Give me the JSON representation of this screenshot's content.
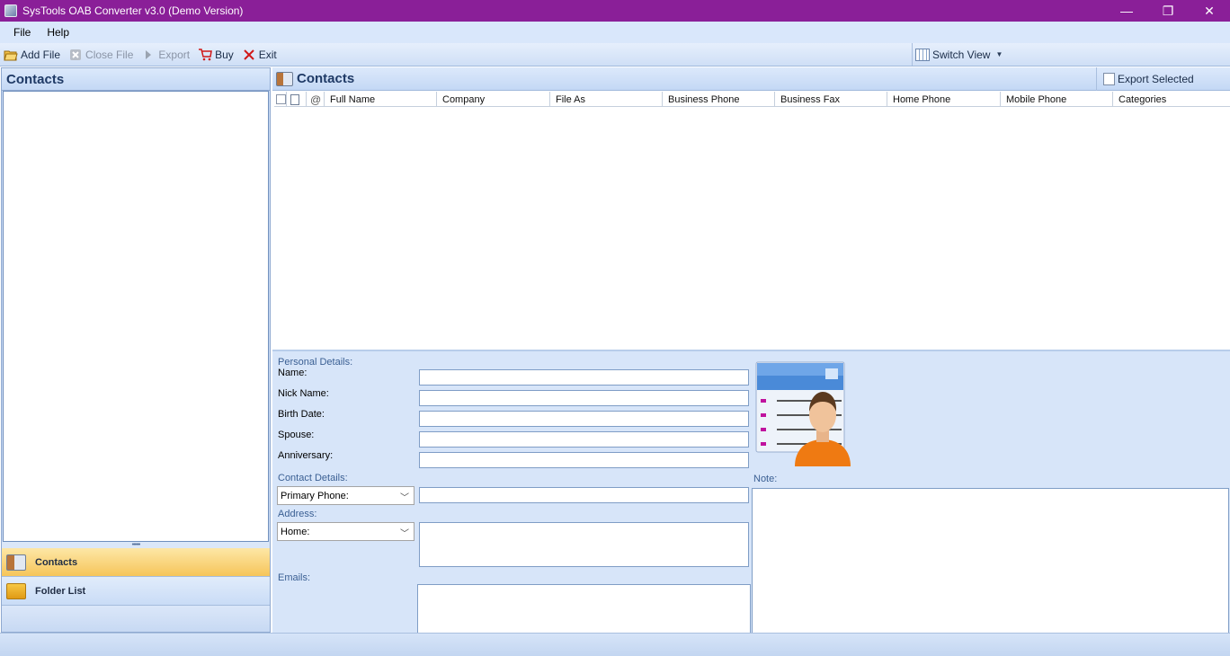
{
  "window": {
    "title": "SysTools OAB Converter v3.0 (Demo Version)",
    "minimize": "—",
    "restore": "❐",
    "close": "✕"
  },
  "menu": {
    "items": [
      "File",
      "Help"
    ]
  },
  "toolbar": {
    "add_file": "Add File",
    "close_file": "Close File",
    "export": "Export",
    "buy": "Buy",
    "exit": "Exit",
    "switch_view": "Switch View"
  },
  "left_panel": {
    "title": "Contacts",
    "nav": {
      "contacts": "Contacts",
      "folder_list": "Folder List"
    }
  },
  "contacts_panel": {
    "title": "Contacts",
    "export_selected": "Export Selected",
    "columns": [
      "Full Name",
      "Company",
      "File As",
      "Business Phone",
      "Business Fax",
      "Home Phone",
      "Mobile Phone",
      "Categories"
    ]
  },
  "details": {
    "personal_label": "Personal Details:",
    "name_label": "Name:",
    "nick_label": "Nick Name:",
    "birth_label": "Birth Date:",
    "spouse_label": "Spouse:",
    "anniversary_label": "Anniversary:",
    "contact_label": "Contact Details:",
    "phone_select": "Primary Phone:",
    "address_label": "Address:",
    "address_select": "Home:",
    "emails_label": "Emails:",
    "note_label": "Note:"
  },
  "colors": {
    "title_bar": "#8a1f98",
    "accent_blue": "#1f3a66",
    "nav_active": "#f6c55a"
  }
}
